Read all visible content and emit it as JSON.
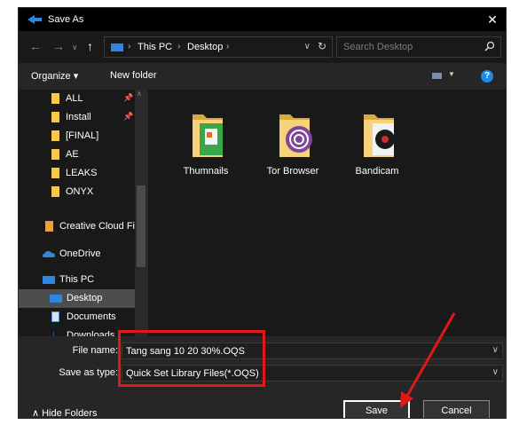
{
  "window": {
    "title": "Save As",
    "close_icon": "close-icon"
  },
  "nav": {
    "breadcrumbs": [
      "This PC",
      "Desktop"
    ],
    "search_placeholder": "Search Desktop"
  },
  "toolbar": {
    "organize_label": "Organize ▾",
    "new_folder_label": "New folder",
    "help_label": "?"
  },
  "sidebar": {
    "items": [
      {
        "label": "ALL",
        "icon": "folder-icon",
        "pinned": true
      },
      {
        "label": "Install",
        "icon": "folder-icon",
        "pinned": true
      },
      {
        "label": "[FINAL]",
        "icon": "folder-icon",
        "pinned": false
      },
      {
        "label": "AE",
        "icon": "folder-icon",
        "pinned": false
      },
      {
        "label": "LEAKS",
        "icon": "folder-icon",
        "pinned": false
      },
      {
        "label": "ONYX",
        "icon": "folder-icon",
        "pinned": false
      },
      {
        "label": "Creative Cloud Fil",
        "icon": "creative-cloud-icon",
        "pinned": false
      },
      {
        "label": "OneDrive",
        "icon": "onedrive-icon",
        "pinned": false
      },
      {
        "label": "This PC",
        "icon": "pc-icon",
        "pinned": false
      },
      {
        "label": "Desktop",
        "icon": "desktop-icon",
        "pinned": false,
        "selected": true
      },
      {
        "label": "Documents",
        "icon": "documents-icon",
        "pinned": false
      },
      {
        "label": "Downloads",
        "icon": "downloads-icon",
        "pinned": false
      }
    ]
  },
  "files": [
    {
      "name": "Thumnails",
      "icon": "folder-thumbnails-icon"
    },
    {
      "name": "Tor Browser",
      "icon": "folder-tor-icon"
    },
    {
      "name": "Bandicam",
      "icon": "folder-bandicam-icon"
    }
  ],
  "form": {
    "file_name_label": "File name:",
    "file_name_value": "Tang sang 10 20 30%.OQS",
    "save_type_label": "Save as type:",
    "save_type_value": "Quick Set Library Files(*.OQS)"
  },
  "footer": {
    "hide_folders_label": "∧  Hide Folders",
    "save_label": "Save",
    "cancel_label": "Cancel"
  },
  "colors": {
    "accent": "#1f8ae8",
    "annotation": "#e01818",
    "folder": "#f7c84a"
  }
}
